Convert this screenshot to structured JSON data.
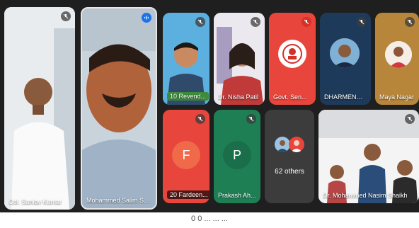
{
  "app": "Video meeting",
  "participants": [
    {
      "name": "Col. Sanjay Kumar",
      "mic": "muted"
    },
    {
      "name": "Mohammed Salim Shaikh",
      "mic": "speaking"
    },
    {
      "name": "10 Revend...",
      "mic": "muted"
    },
    {
      "name": "Dr. Nisha Patil",
      "mic": "muted"
    },
    {
      "name": "Govt. Sen...",
      "mic": "muted-red"
    },
    {
      "name": "DHARMENDR...",
      "mic": "muted"
    },
    {
      "name": "Maya Nagar",
      "mic": "muted"
    },
    {
      "name": "20 Fardeen...",
      "initial": "F",
      "mic": "muted"
    },
    {
      "name": "Prakash Ah...",
      "initial": "P",
      "mic": "muted"
    },
    {
      "name": "62 others"
    },
    {
      "name": "Dr. Mohammed Nasim Shaikh",
      "mic": "muted"
    }
  ],
  "colors": {
    "red_tile": "#e8453c",
    "green_tile": "#1e7f55",
    "grey_tile": "#3c3c3c",
    "accent": "#1a73e8"
  },
  "bottom_hint": "0  0  ...  ...  ..."
}
